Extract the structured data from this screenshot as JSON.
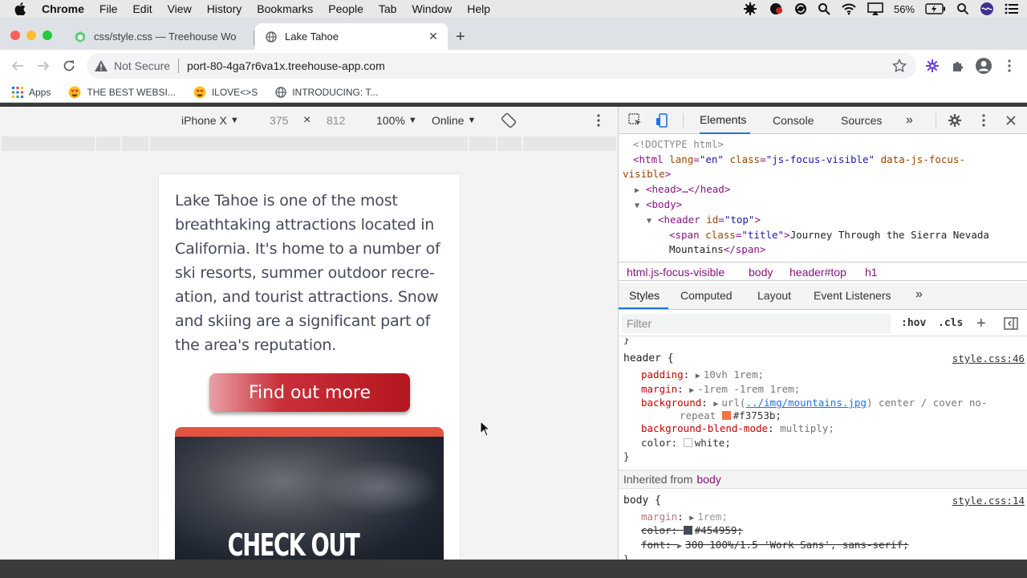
{
  "menubar": {
    "app": "Chrome",
    "items": [
      "File",
      "Edit",
      "View",
      "History",
      "Bookmarks",
      "People",
      "Tab",
      "Window",
      "Help"
    ],
    "battery": "56%"
  },
  "tabs": [
    {
      "title": "css/style.css — Treehouse Wo",
      "active": false
    },
    {
      "title": "Lake Tahoe",
      "active": true
    }
  ],
  "toolbar": {
    "security": "Not Secure",
    "url": "port-80-4ga7r6va1x.treehouse-app.com"
  },
  "bookmarks": [
    "Apps",
    "THE BEST WEBSI...",
    "ILOVE<>S",
    "INTRODUCING: T..."
  ],
  "device_toolbar": {
    "device": "iPhone X",
    "width": "375",
    "times": "×",
    "height": "812",
    "zoom": "100%",
    "network": "Online"
  },
  "page": {
    "paragraph_lines": [
      "Lake Tahoe is one of the most",
      "breathtaking attractions located in",
      "California. It's home to a number of",
      "ski resorts, summer outdoor recre-",
      "ation, and tourist attractions. Snow",
      "and skiing are a significant part of",
      "the area's reputation."
    ],
    "cta_label": "Find out more",
    "card_heading": "CHECK OUT THE"
  },
  "devtools": {
    "tabs": [
      "Elements",
      "Console",
      "Sources"
    ],
    "active_tab": "Elements",
    "dom": {
      "doctype": "<!DOCTYPE html>",
      "html_open": "<html",
      "html_attr1": "lang",
      "html_val1": "\"en\"",
      "html_attr2": "class",
      "html_val2": "\"js-focus-visible\"",
      "html_attr3": "data-js-focus-",
      "html_attr3b": "visible",
      "head": "<head>…</head>",
      "body": "<body>",
      "header_open": "<header",
      "header_attr": "id",
      "header_val": "\"top\"",
      "span_open": "<span",
      "span_attr": "class",
      "span_val": "\"title\"",
      "span_text": "Journey Through the Sierra Nevada",
      "span_text2": "Mountains",
      "span_close": "</span>"
    },
    "breadcrumbs": [
      "html.js-focus-visible",
      "body",
      "header#top",
      "h1"
    ],
    "subtabs": [
      "Styles",
      "Computed",
      "Layout",
      "Event Listeners"
    ],
    "filter_placeholder": "Filter",
    "hov": ":hov",
    "cls": ".cls",
    "rule1": {
      "selector": "header",
      "source": "style.css:46",
      "decls": [
        {
          "prop": "padding",
          "value": "10vh 1rem;"
        },
        {
          "prop": "margin",
          "value": "-1rem -1rem 1rem;"
        },
        {
          "prop": "background",
          "value_pre": "url(",
          "link": "../img/mountains.jpg",
          "value_post": ") center / cover no-",
          "value_cont": "repeat",
          "swatch_value": "#f3753b;"
        },
        {
          "prop": "background-blend-mode",
          "value": "multiply;"
        },
        {
          "prop": "color",
          "value": "white;"
        }
      ]
    },
    "inherited_label": "Inherited from",
    "inherited_from": "body",
    "rule2": {
      "selector": "body",
      "source": "style.css:14",
      "decls": [
        {
          "prop": "margin",
          "value": "1rem;"
        },
        {
          "prop": "color",
          "value": "#454959;"
        },
        {
          "prop": "font",
          "value": "300 100%/1.5 'Work Sans', sans-serif;"
        }
      ]
    }
  },
  "colors": {
    "accent": "#1a73e8",
    "cta": "#b5161f",
    "card_top": "#e1543e",
    "text": "#454959",
    "header_bg": "#f3753b"
  }
}
